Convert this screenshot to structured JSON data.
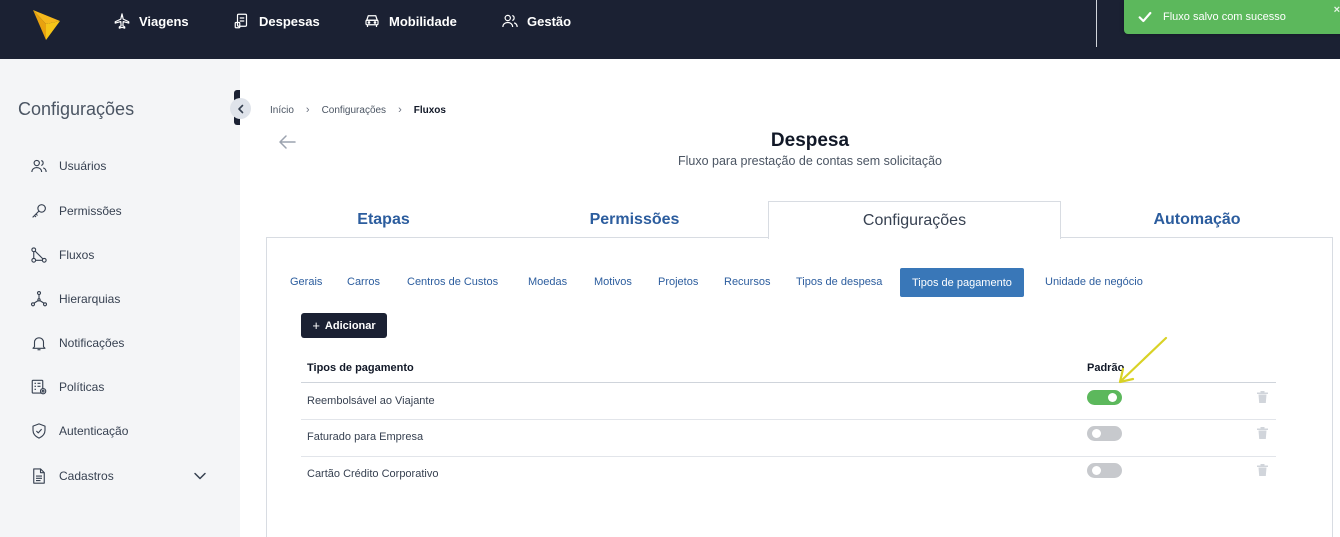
{
  "topbar": {
    "nav": [
      {
        "label": "Viagens",
        "icon": "airplane-icon"
      },
      {
        "label": "Despesas",
        "icon": "receipt-icon"
      },
      {
        "label": "Mobilidade",
        "icon": "car-icon"
      },
      {
        "label": "Gestão",
        "icon": "users-icon"
      }
    ],
    "toast": {
      "message": "Fluxo salvo com sucesso",
      "close": "×",
      "color": "#5cb85c"
    }
  },
  "sidebar": {
    "title": "Configurações",
    "items": [
      {
        "label": "Usuários",
        "icon": "users-icon"
      },
      {
        "label": "Permissões",
        "icon": "key-icon"
      },
      {
        "label": "Fluxos",
        "icon": "flow-icon"
      },
      {
        "label": "Hierarquias",
        "icon": "hierarchy-icon"
      },
      {
        "label": "Notificações",
        "icon": "bell-icon"
      },
      {
        "label": "Políticas",
        "icon": "policy-icon"
      },
      {
        "label": "Autenticação",
        "icon": "shield-icon"
      },
      {
        "label": "Cadastros",
        "icon": "document-icon"
      }
    ]
  },
  "breadcrumb": [
    "Início",
    "Configurações",
    "Fluxos"
  ],
  "page": {
    "title": "Despesa",
    "subtitle": "Fluxo para prestação de contas sem solicitação"
  },
  "tabs": [
    "Etapas",
    "Permissões",
    "Configurações",
    "Automação"
  ],
  "active_tab": "Configurações",
  "subtabs": [
    "Gerais",
    "Carros",
    "Centros de Custos",
    "Moedas",
    "Motivos",
    "Projetos",
    "Recursos",
    "Tipos de despesa",
    "Tipos de pagamento",
    "Unidade de negócio"
  ],
  "active_subtab": "Tipos de pagamento",
  "add_button": {
    "plus": "+",
    "label": "Adicionar"
  },
  "table": {
    "headers": {
      "name": "Tipos de pagamento",
      "default": "Padrão"
    },
    "rows": [
      {
        "name": "Reembolsável ao Viajante",
        "default": true
      },
      {
        "name": "Faturado para Empresa",
        "default": false
      },
      {
        "name": "Cartão Crédito Corporativo",
        "default": false
      }
    ]
  },
  "colors": {
    "navy": "#1b2133",
    "accent_blue": "#3977b8",
    "link_blue": "#2c5d9e",
    "toggle_on": "#5cb85c",
    "annotation": "#d9d226"
  }
}
